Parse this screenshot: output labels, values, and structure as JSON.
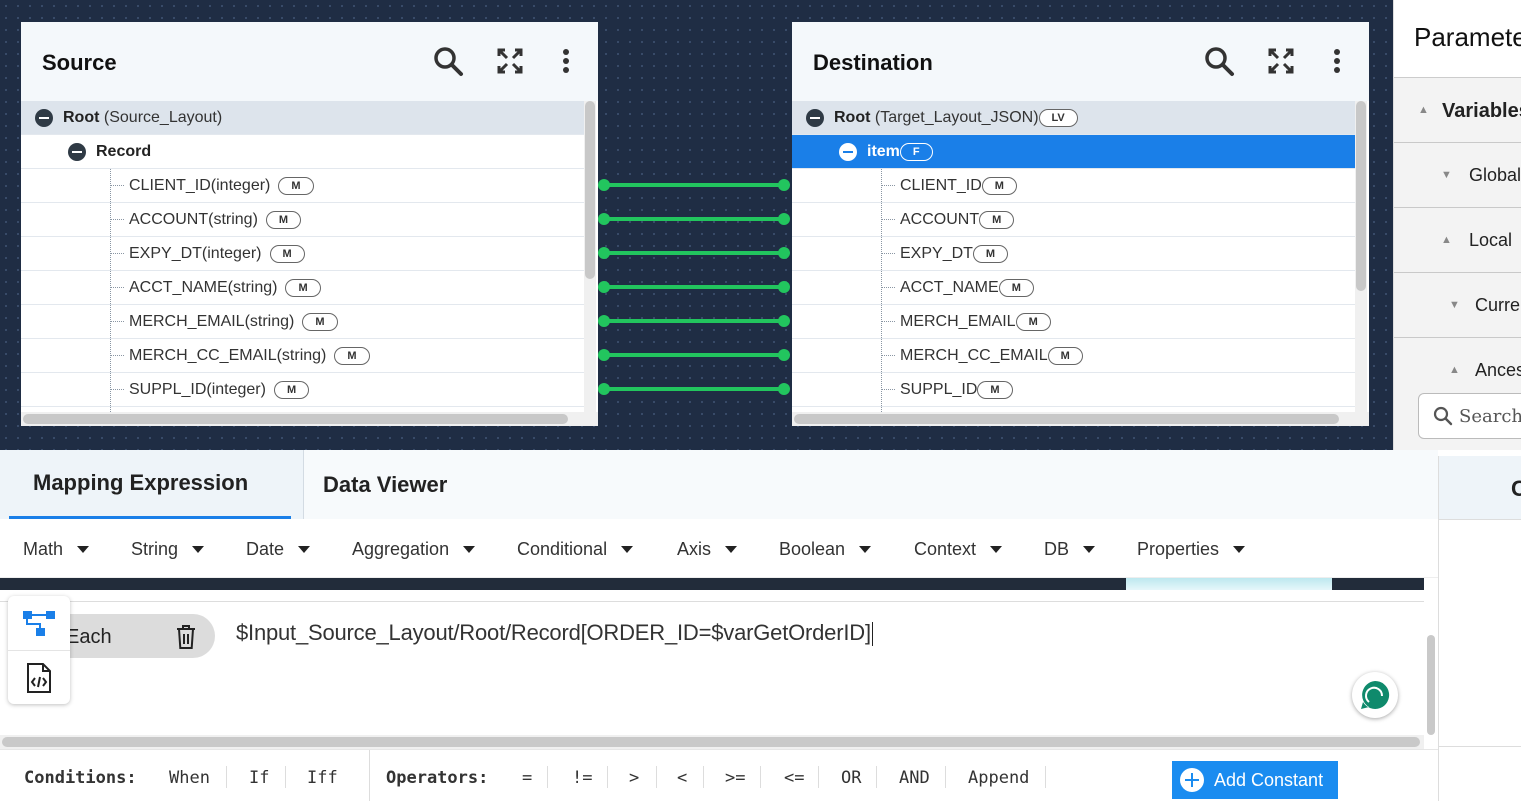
{
  "source": {
    "title": "Source",
    "root_name": "Root",
    "root_type": "(Source_Layout)",
    "group_name": "Record",
    "fields": [
      {
        "label": "CLIENT_ID(integer)",
        "badge": "M"
      },
      {
        "label": "ACCOUNT(string)",
        "badge": "M"
      },
      {
        "label": "EXPY_DT(integer)",
        "badge": "M"
      },
      {
        "label": "ACCT_NAME(string)",
        "badge": "M"
      },
      {
        "label": "MERCH_EMAIL(string)",
        "badge": "M"
      },
      {
        "label": "MERCH_CC_EMAIL(string)",
        "badge": "M"
      },
      {
        "label": "SUPPL_ID(integer)",
        "badge": "M"
      }
    ]
  },
  "destination": {
    "title": "Destination",
    "root_name": "Root",
    "root_type": "(Target_Layout_JSON)",
    "root_badge": "LV",
    "group_name": "item",
    "group_badge": "F",
    "fields": [
      {
        "label": "CLIENT_ID",
        "badge": "M"
      },
      {
        "label": "ACCOUNT",
        "badge": "M"
      },
      {
        "label": "EXPY_DT",
        "badge": "M"
      },
      {
        "label": "ACCT_NAME",
        "badge": "M"
      },
      {
        "label": "MERCH_EMAIL",
        "badge": "M"
      },
      {
        "label": "MERCH_CC_EMAIL",
        "badge": "M"
      },
      {
        "label": "SUPPL_ID",
        "badge": "M"
      }
    ]
  },
  "parameters": {
    "title": "Paramete",
    "variables": "Variables",
    "global": "Global",
    "local": "Local",
    "current": "Curren",
    "ancestor": "Ances",
    "search_placeholder": "Search"
  },
  "tabs": {
    "mapping": "Mapping Expression",
    "viewer": "Data Viewer",
    "right": "C"
  },
  "toolbar": [
    "Math",
    "String",
    "Date",
    "Aggregation",
    "Conditional",
    "Axis",
    "Boolean",
    "Context",
    "DB",
    "Properties"
  ],
  "expression": {
    "function_label": "Each",
    "text": "$Input_Source_Layout/Root/Record[ORDER_ID=$varGetOrderID]"
  },
  "conditions": {
    "label": "Conditions:",
    "items": [
      "When",
      "If",
      "Iff"
    ]
  },
  "operators": {
    "label": "Operators:",
    "items": [
      "=",
      "!=",
      ">",
      "<",
      ">=",
      "<=",
      "OR",
      "AND",
      "Append"
    ]
  },
  "add_constant": "Add Constant",
  "colors": {
    "accent": "#1a7fe8",
    "connector": "#22c55e",
    "canvas": "#1f2d44"
  }
}
